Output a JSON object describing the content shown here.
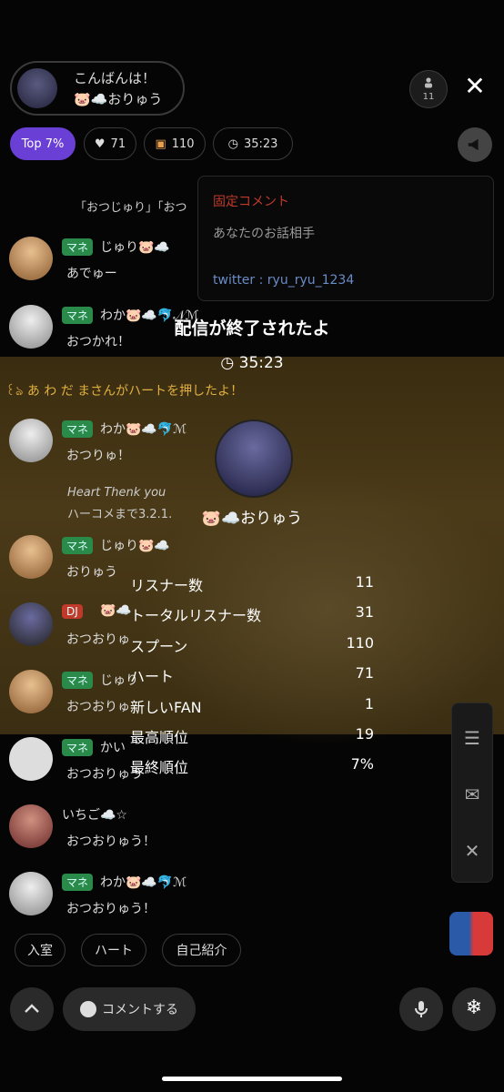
{
  "header": {
    "greeting": "こんばんは！",
    "host_name": "🐷☁️おりゅう",
    "listener_count": "11"
  },
  "chips": {
    "top": "Top 7%",
    "hearts": "71",
    "spoons": "110",
    "time": "35:23"
  },
  "pinned": {
    "title": "固定コメント",
    "body": "あなたのお話相手",
    "contact": "twitter : ryu_ryu_1234"
  },
  "chat": {
    "system_line": "「おつじゅり」「おつ",
    "messages": [
      {
        "badge": "マネ",
        "name": "じゅり🐷☁️",
        "text": "あでゅー"
      },
      {
        "badge": "マネ",
        "name": "わか🐷☁️🐬𝒩ℳ",
        "text": "おつかれ！"
      },
      {
        "badge": "マネ",
        "name": "わか🐷☁️🐬ℳ",
        "text": "おつりゅ！"
      },
      {
        "badge": "マネ",
        "name": "じゅり🐷☁️",
        "text": "おりゅう"
      },
      {
        "badge": "DJ",
        "name": "🐷☁️",
        "text": "おつおりゅ"
      },
      {
        "badge": "マネ",
        "name": "じゅり",
        "text": "おつおりゅ"
      },
      {
        "badge": "マネ",
        "name": "かい",
        "text": "おつおりゅう"
      },
      {
        "badge": "",
        "name": "いちご☁️☆",
        "text": "おつおりゅう！"
      },
      {
        "badge": "マネ",
        "name": "わか🐷☁️🐬ℳ",
        "text": "おつおりゅう！"
      }
    ],
    "heart_notice": "꒰ঌ あ わ だ まさんがハートを押したよ！",
    "heart_thank": "Heart Thenk you",
    "heart_come": "ハーコメまで3.2.1."
  },
  "overlay": {
    "title": "配信が終了されたよ",
    "duration": "35:23",
    "host_name": "🐷☁️おりゅう",
    "stats": [
      {
        "label": "リスナー数",
        "value": "11"
      },
      {
        "label": "トータルリスナー数",
        "value": "31"
      },
      {
        "label": "スプーン",
        "value": "110"
      },
      {
        "label": "ハート",
        "value": "71"
      },
      {
        "label": "新しいFAN",
        "value": "1"
      },
      {
        "label": "最高順位",
        "value": "19"
      },
      {
        "label": "最終順位",
        "value": "7%"
      }
    ]
  },
  "quick": {
    "enter": "入室",
    "heart": "ハート",
    "intro": "自己紹介"
  },
  "bottom": {
    "comment": "コメントする"
  },
  "colors": {
    "accent": "#6a3fd6",
    "badge_green": "#2a8a4a",
    "pinned_title": "#c0392b"
  }
}
